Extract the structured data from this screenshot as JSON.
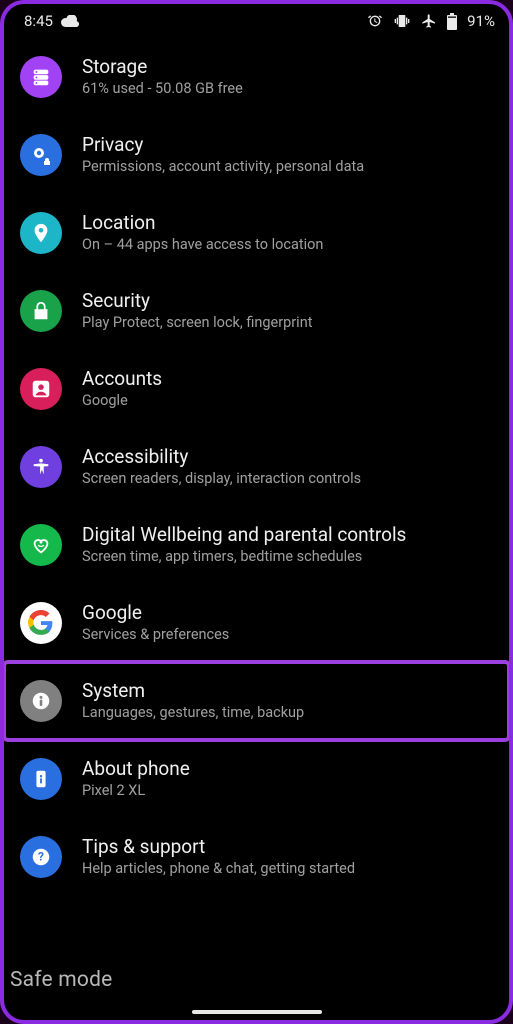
{
  "status": {
    "time": "8:45",
    "battery_pct": "91%"
  },
  "settings": [
    {
      "key": "storage",
      "title": "Storage",
      "sub": "61% used - 50.08 GB free",
      "color": "#a142f5"
    },
    {
      "key": "privacy",
      "title": "Privacy",
      "sub": "Permissions, account activity, personal data",
      "color": "#2a6fe0"
    },
    {
      "key": "location",
      "title": "Location",
      "sub": "On – 44 apps have access to location",
      "color": "#1db6c9"
    },
    {
      "key": "security",
      "title": "Security",
      "sub": "Play Protect, screen lock, fingerprint",
      "color": "#1aa24a"
    },
    {
      "key": "accounts",
      "title": "Accounts",
      "sub": "Google",
      "color": "#d81f5b"
    },
    {
      "key": "accessibility",
      "title": "Accessibility",
      "sub": "Screen readers, display, interaction controls",
      "color": "#6f3fe0"
    },
    {
      "key": "wellbeing",
      "title": "Digital Wellbeing and parental controls",
      "sub": "Screen time, app timers, bedtime schedules",
      "color": "#15b84b"
    },
    {
      "key": "google",
      "title": "Google",
      "sub": "Services & preferences",
      "color": "#ffffff"
    },
    {
      "key": "system",
      "title": "System",
      "sub": "Languages, gestures, time, backup",
      "color": "#808080",
      "highlight": true
    },
    {
      "key": "about",
      "title": "About phone",
      "sub": "Pixel 2 XL",
      "color": "#2a6fe0"
    },
    {
      "key": "tips",
      "title": "Tips & support",
      "sub": "Help articles, phone & chat, getting started",
      "color": "#2a6fe0"
    }
  ],
  "overlay": {
    "safe_mode": "Safe mode"
  }
}
